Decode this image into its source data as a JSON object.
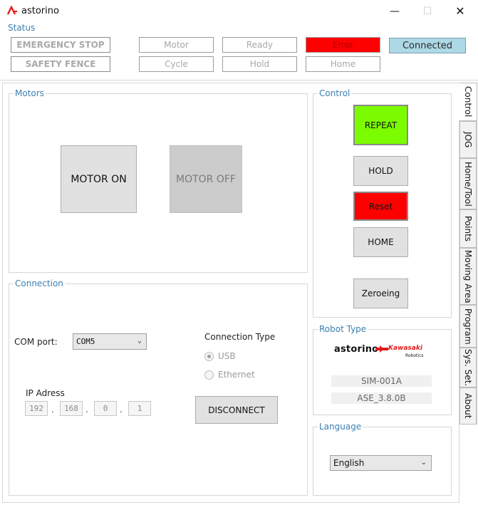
{
  "window": {
    "title": "astorino",
    "minimize_glyph": "—",
    "maximize_glyph": "☐",
    "close_glyph": "✕"
  },
  "status": {
    "label": "Status",
    "emergency_stop": "EMERGENCY STOP",
    "safety_fence": "SAFETY FENCE",
    "motor": "Motor",
    "cycle": "Cycle",
    "ready": "Ready",
    "hold": "Hold",
    "error": "Error",
    "home": "Home",
    "connected": "Connected"
  },
  "motors": {
    "label": "Motors",
    "motor_on": "MOTOR ON",
    "motor_off": "MOTOR OFF"
  },
  "control": {
    "label": "Control",
    "repeat": "REPEAT",
    "hold": "HOLD",
    "reset": "Reset",
    "home": "HOME",
    "zeroing": "Zeroeing"
  },
  "connection": {
    "label": "Connection",
    "com_label": "COM port:",
    "com_value": "COM5",
    "type_label": "Connection Type",
    "usb": "USB",
    "ethernet": "Ethernet",
    "selected_type": "USB",
    "ip_label": "IP Adress",
    "ip": [
      "192",
      "168",
      "0",
      "1"
    ],
    "disconnect": "DISCONNECT"
  },
  "robot_type": {
    "label": "Robot Type",
    "brand": "astorino",
    "maker": "Kawasaki",
    "maker_sub": "Robotics",
    "model": "SIM-001A",
    "version": "ASE_3.8.0B"
  },
  "language": {
    "label": "Language",
    "value": "English"
  },
  "tabs": [
    {
      "label": "Control",
      "active": true
    },
    {
      "label": "JOG"
    },
    {
      "label": "Home/Tool"
    },
    {
      "label": "Points"
    },
    {
      "label": "Moving Area"
    },
    {
      "label": "Program"
    },
    {
      "label": "Sys. Set."
    },
    {
      "label": "About"
    }
  ],
  "colors": {
    "accent": "#3c7fb1",
    "error": "#ff0000",
    "repeat": "#7cfc00",
    "connected": "#add8e6",
    "brand_red": "#e31b1b"
  },
  "icons": {
    "app": "astorino-logo-icon",
    "dropdown": "chevron-down-icon"
  }
}
